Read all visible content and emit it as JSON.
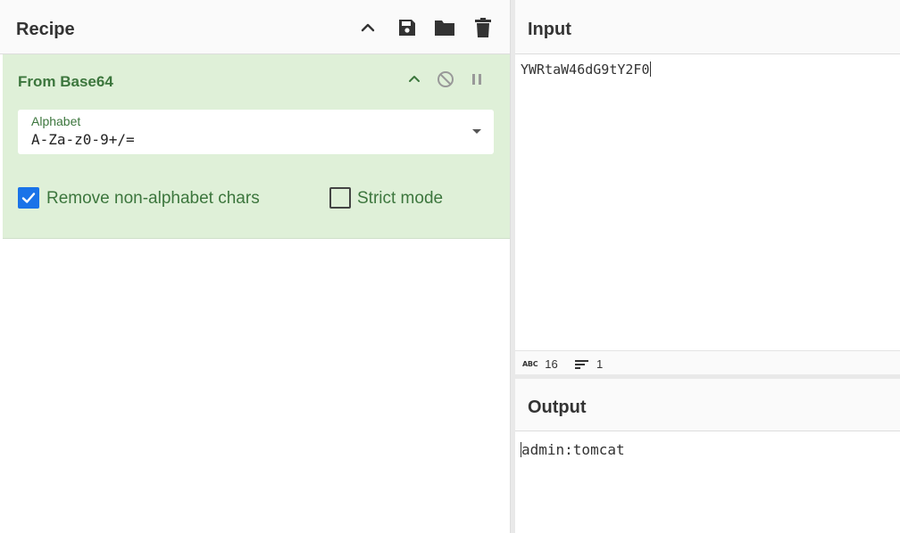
{
  "recipe": {
    "title": "Recipe",
    "header_icons": [
      "chevron-up-icon",
      "save-icon",
      "folder-icon",
      "trash-icon"
    ],
    "operation": {
      "name": "From Base64",
      "alphabet_label": "Alphabet",
      "alphabet_value": "A-Za-z0-9+/=",
      "remove_non_alphabet": {
        "label": "Remove non-alphabet chars",
        "checked": true
      },
      "strict_mode": {
        "label": "Strict mode",
        "checked": false
      }
    }
  },
  "input": {
    "title": "Input",
    "text": "YWRtaW46dG9tY2F0",
    "status": {
      "length": "16",
      "lines": "1"
    }
  },
  "output": {
    "title": "Output",
    "text": "admin:tomcat"
  },
  "colors": {
    "operation_bg": "#dff0d8",
    "operation_text": "#3c763d",
    "checkbox_checked": "#1a73e8"
  }
}
